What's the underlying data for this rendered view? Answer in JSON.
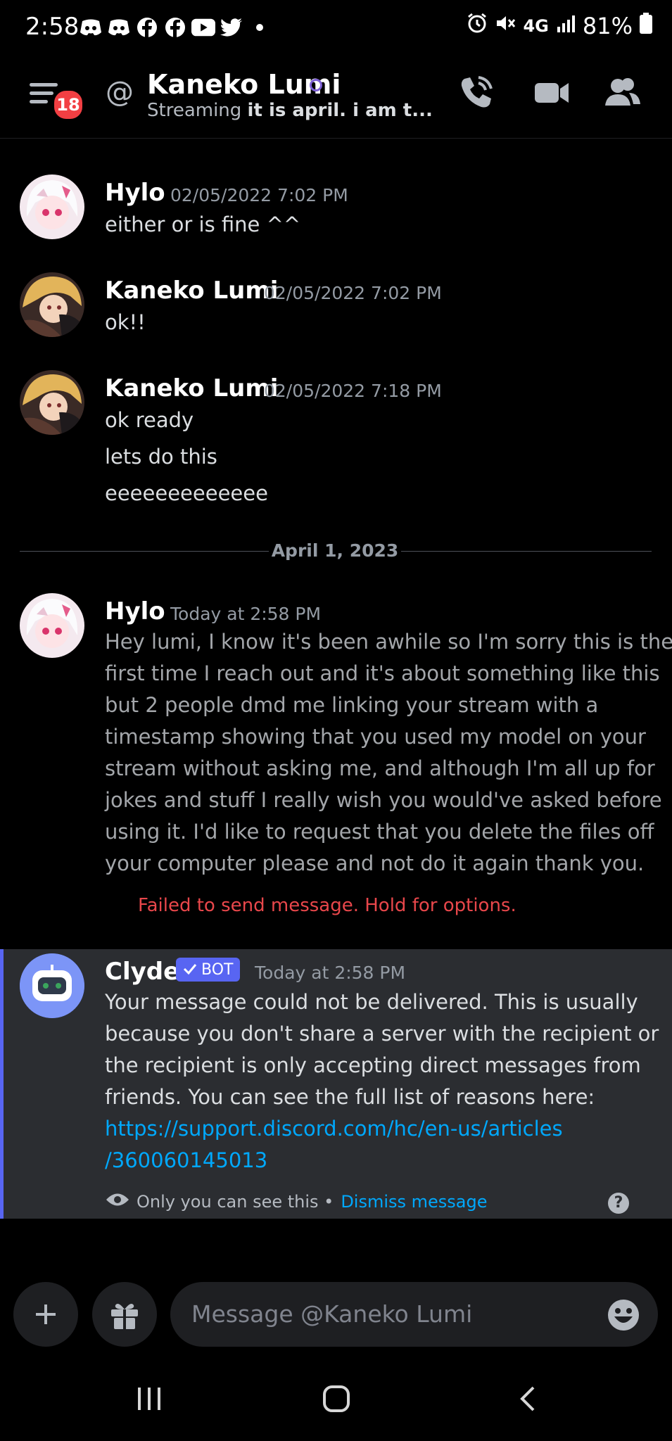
{
  "status_bar": {
    "time": "2:58",
    "battery": "81%",
    "network": "4G"
  },
  "header": {
    "badge_count": "18",
    "at_symbol": "@",
    "dm_name": "Kaneko Lumi",
    "status_prefix": "Streaming",
    "status_activity": "it is april. i am t..."
  },
  "messages": [
    {
      "username": "Hylo",
      "timestamp": "02/05/2022 7:02 PM",
      "lines": [
        "either or is fine ^^"
      ]
    },
    {
      "username": "Kaneko Lumi",
      "timestamp": "02/05/2022 7:02 PM",
      "lines": [
        "ok!!"
      ]
    },
    {
      "username": "Kaneko Lumi",
      "timestamp": "02/05/2022 7:18 PM",
      "lines": [
        "ok ready",
        "lets do this",
        "eeeeeeeeeeeee"
      ]
    }
  ],
  "date_divider": "April 1, 2023",
  "failed_message": {
    "username": "Hylo",
    "timestamp": "Today at 2:58 PM",
    "lines": [
      "Hey lumi, I know it's been awhile so I'm sorry this is the",
      "first time I reach out and it's about something like this",
      "but 2 people dmd me linking your stream with a",
      "timestamp showing that you used my model on your",
      "stream without asking me, and although I'm all up for",
      "jokes and stuff I really wish you would've asked before",
      "using it. I'd like to request that you delete the files off",
      "your computer please and not do it again thank you."
    ],
    "error": "Failed to send message. Hold for options."
  },
  "clyde": {
    "username": "Clyde",
    "bot_tag": "BOT",
    "timestamp": "Today at 2:58 PM",
    "lines": [
      "Your message could not be delivered. This is usually",
      "because you don't share a server with the recipient or",
      "the recipient is only accepting direct messages from",
      "friends. You can see the full list of reasons here:"
    ],
    "link_lines": [
      "https://support.discord.com/hc/en-us/articles",
      "/360060145013"
    ],
    "ephemeral_note": "Only you can see this •",
    "dismiss": "Dismiss message",
    "help": "?"
  },
  "composer": {
    "placeholder": "Message @Kaneko Lumi"
  },
  "colors": {
    "accent": "#5865f2",
    "error": "#e8474b",
    "link": "#00a8fc",
    "badge": "#f23f43"
  }
}
